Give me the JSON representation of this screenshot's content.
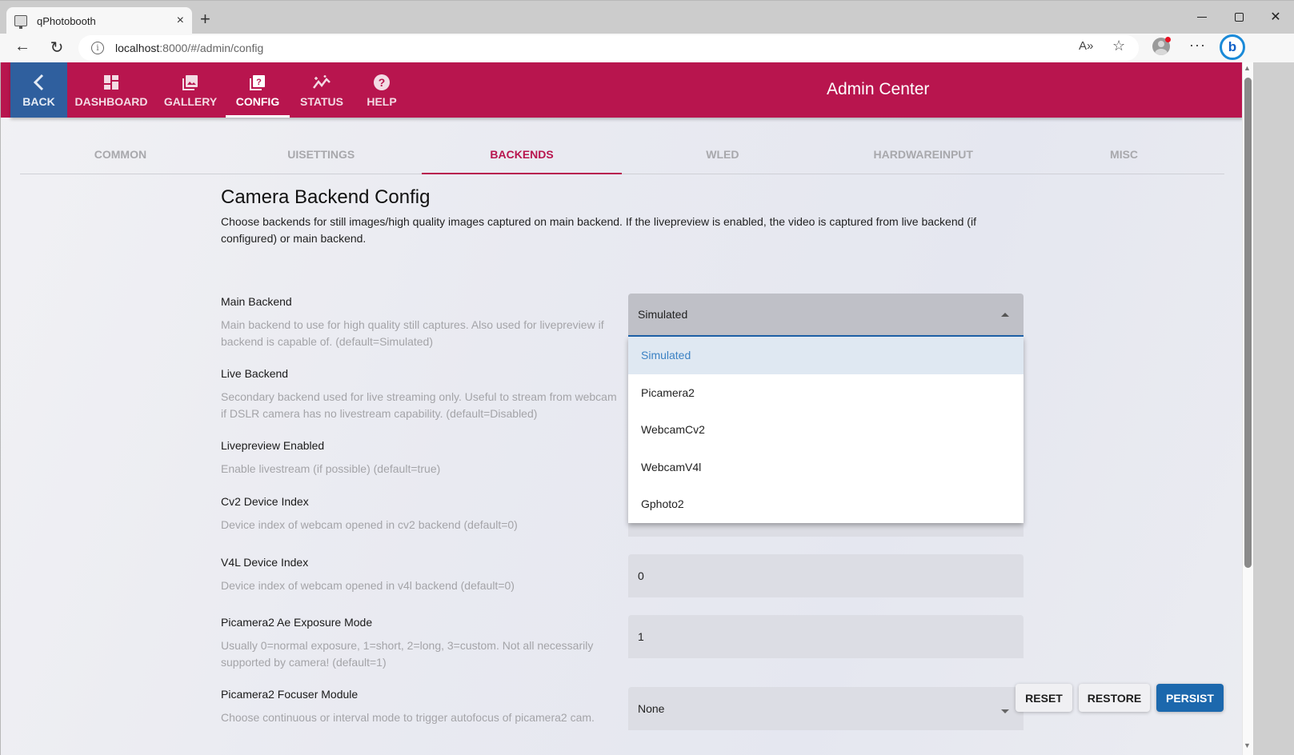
{
  "browser": {
    "tab_title": "qPhotobooth",
    "tab_close": "×",
    "new_tab": "+",
    "url_host": "localhost",
    "url_rest": ":8000/#/admin/config",
    "back_icon": "←",
    "reload_icon": "↻",
    "info_icon": "i",
    "read_aloud_icon": "A»",
    "favorites_icon": "☆",
    "more_icon": "···",
    "bing_icon": "b",
    "close_window": "✕"
  },
  "header": {
    "title": "Admin Center",
    "nav": [
      {
        "label": "BACK",
        "icon": "chevron-left"
      },
      {
        "label": "DASHBOARD",
        "icon": "dashboard"
      },
      {
        "label": "GALLERY",
        "icon": "gallery"
      },
      {
        "label": "CONFIG",
        "icon": "config",
        "active": true
      },
      {
        "label": "STATUS",
        "icon": "status"
      },
      {
        "label": "HELP",
        "icon": "help"
      }
    ]
  },
  "subtabs": [
    {
      "label": "COMMON"
    },
    {
      "label": "UISETTINGS"
    },
    {
      "label": "BACKENDS",
      "active": true
    },
    {
      "label": "WLED"
    },
    {
      "label": "HARDWAREINPUT"
    },
    {
      "label": "MISC"
    }
  ],
  "section": {
    "title": "Camera Backend Config",
    "description": "Choose backends for still images/high quality images captured on main backend. If the livepreview is enabled, the video is captured from live backend (if configured) or main backend."
  },
  "fields": [
    {
      "label": "Main Backend",
      "help": "Main backend to use for high quality still captures. Also used for livepreview if backend is capable of. (default=Simulated)",
      "value": "Simulated"
    },
    {
      "label": "Live Backend",
      "help": "Secondary backend used for live streaming only. Useful to stream from webcam if DSLR camera has no livestream capability. (default=Disabled)"
    },
    {
      "label": "Livepreview Enabled",
      "help": "Enable livestream (if possible) (default=true)"
    },
    {
      "label": "Cv2 Device Index",
      "help": "Device index of webcam opened in cv2 backend (default=0)"
    },
    {
      "label": "V4L Device Index",
      "help": "Device index of webcam opened in v4l backend (default=0)",
      "value": "0"
    },
    {
      "label": "Picamera2 Ae Exposure Mode",
      "help": "Usually 0=normal exposure, 1=short, 2=long, 3=custom. Not all necessarily supported by camera! (default=1)",
      "value": "1"
    },
    {
      "label": "Picamera2 Focuser Module",
      "help": "Choose continuous or interval mode to trigger autofocus of picamera2 cam.",
      "value": "None"
    }
  ],
  "dropdown": {
    "options": [
      "Simulated",
      "Picamera2",
      "WebcamCv2",
      "WebcamV4l",
      "Gphoto2"
    ],
    "selected": "Simulated"
  },
  "actions": {
    "reset": "RESET",
    "restore": "RESTORE",
    "persist": "PERSIST"
  },
  "colors": {
    "brand": "#b8154e",
    "back_button": "#2f5f9e",
    "primary_button": "#1c68ad",
    "selected_option": "#3c82c4"
  }
}
